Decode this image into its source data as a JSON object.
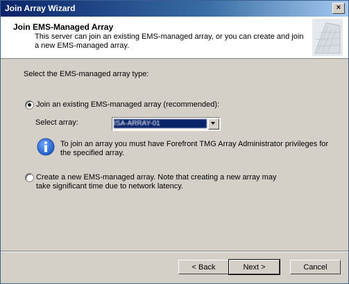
{
  "window": {
    "title": "Join Array Wizard",
    "close_glyph": "×"
  },
  "header": {
    "title": "Join EMS-Managed Array",
    "description": "This server can join an existing EMS-managed array, or you can create and join a new EMS-managed array."
  },
  "main": {
    "prompt": "Select the EMS-managed array type:",
    "option_join": {
      "label": "Join an existing EMS-managed array (recommended):",
      "selected": true
    },
    "select_array": {
      "label": "Select array:",
      "value": "ISA-ARRAY-01"
    },
    "info_text": "To join an array you must have Forefront TMG Array Administrator privileges for the specified array.",
    "option_create": {
      "label": "Create a new EMS-managed array. Note that creating a new array may take significant time due to network latency.",
      "selected": false
    }
  },
  "footer": {
    "back_label": "< Back",
    "next_label": "Next >",
    "cancel_label": "Cancel"
  },
  "colors": {
    "titlebar": "#0a246a",
    "face": "#d4d0c8",
    "info_icon": "#1e5bc6"
  },
  "icons": [
    "close-icon",
    "info-icon",
    "chevron-down-icon",
    "wizard-graphic-icon"
  ]
}
